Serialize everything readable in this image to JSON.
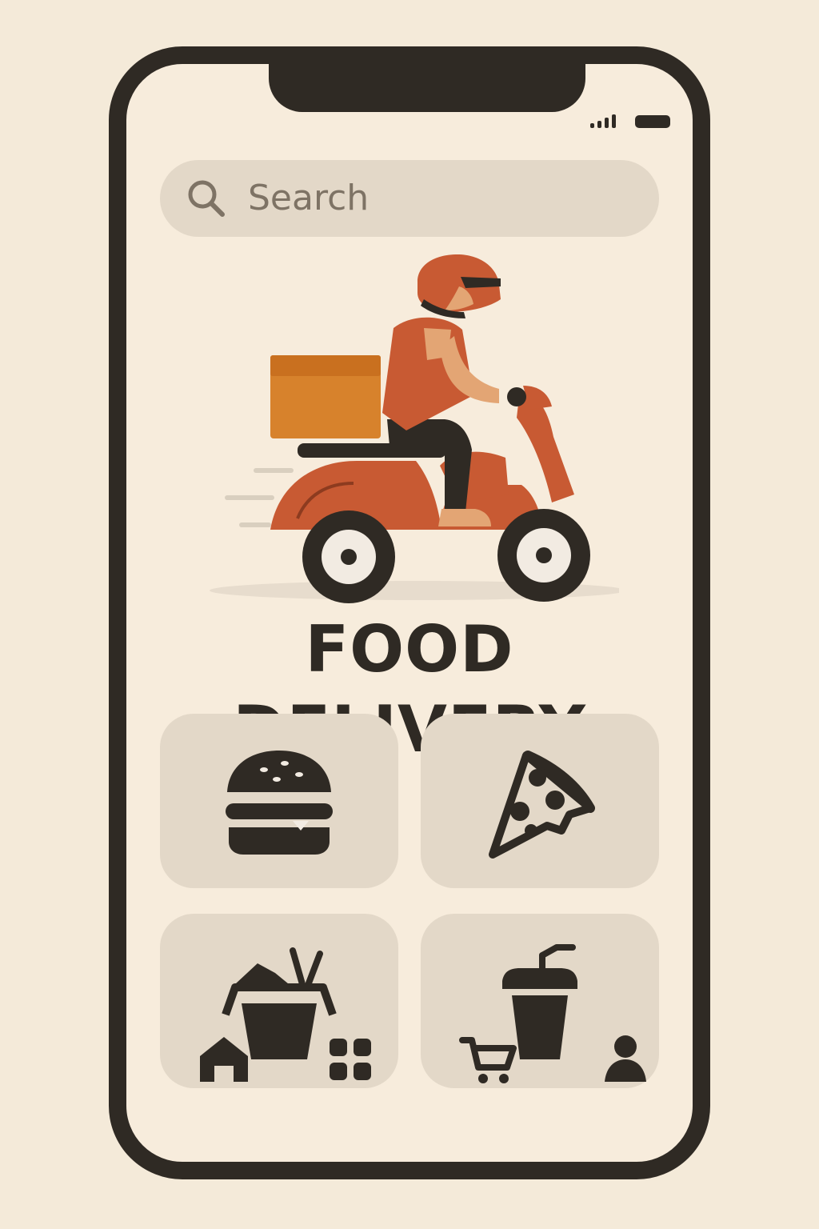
{
  "search": {
    "placeholder": "Search",
    "icon": "search-icon"
  },
  "hero": {
    "title": "FOOD DELIVERY"
  },
  "categories": [
    {
      "icon": "burger-icon"
    },
    {
      "icon": "pizza-icon"
    },
    {
      "icon": "noodles-icon"
    },
    {
      "icon": "drink-icon"
    }
  ],
  "bottom_nav": [
    {
      "icon": "home-icon"
    },
    {
      "icon": "grid-icon"
    },
    {
      "icon": "cart-icon"
    },
    {
      "icon": "profile-icon"
    }
  ],
  "colors": {
    "background": "#f4ead9",
    "screen": "#f7ecdc",
    "tile": "#e3d8c8",
    "ink": "#2f2a24",
    "accent": "#c85a33",
    "box": "#d7822c",
    "skin": "#e3a574"
  }
}
